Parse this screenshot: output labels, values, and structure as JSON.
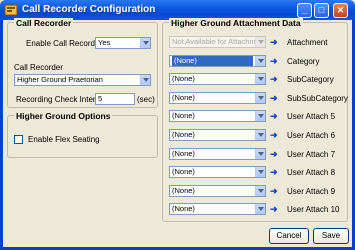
{
  "window": {
    "title": "Call Recorder Configuration"
  },
  "call_recorder": {
    "group_title": "Call Recorder",
    "enable_label": "Enable Call Recording:",
    "enable_value": "Yes",
    "recorder_label": "Call Recorder",
    "recorder_value": "Higher Ground Praetorian",
    "interval_label": "Recording Check Interval:",
    "interval_value": "5",
    "interval_unit": "(sec)"
  },
  "hg_options": {
    "group_title": "Higher Ground Options",
    "flex_label": "Enable Flex Seating",
    "flex_checked": false
  },
  "attachment": {
    "group_title": "Higher Ground Attachment Data",
    "rows": [
      {
        "value": "Not Available for Attachment",
        "label": "Attachment",
        "state": "disabled"
      },
      {
        "value": "(None)",
        "label": "Category",
        "state": "selected"
      },
      {
        "value": "(None)",
        "label": "SubCategory",
        "state": "normal"
      },
      {
        "value": "(None)",
        "label": "SubSubCategory",
        "state": "normal"
      },
      {
        "value": "(None)",
        "label": "User Attach 5",
        "state": "normal"
      },
      {
        "value": "(None)",
        "label": "User Attach 6",
        "state": "normal"
      },
      {
        "value": "(None)",
        "label": "User Attach 7",
        "state": "normal"
      },
      {
        "value": "(None)",
        "label": "User Attach 8",
        "state": "normal"
      },
      {
        "value": "(None)",
        "label": "User Attach 9",
        "state": "normal"
      },
      {
        "value": "(None)",
        "label": "User Attach 10",
        "state": "normal"
      }
    ]
  },
  "buttons": {
    "cancel": "Cancel",
    "save": "Save"
  },
  "colors": {
    "titlebar": "#0b58e0",
    "selection": "#316ac5",
    "arrow": "#1244c8"
  }
}
